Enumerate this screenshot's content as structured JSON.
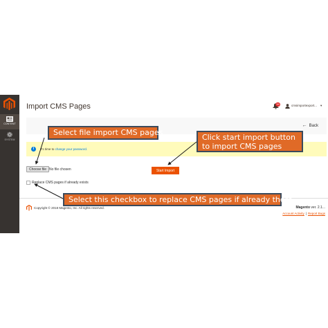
{
  "page": {
    "title": "Import CMS Pages",
    "back_label": "Back"
  },
  "sidenav": {
    "items": [
      {
        "label": "CONTENT",
        "icon": "content-icon",
        "active": true
      },
      {
        "label": "SYSTEM",
        "icon": "gear-icon",
        "active": false
      }
    ]
  },
  "header": {
    "notification_count": "39",
    "user_name": "cmsimportexport..."
  },
  "message": {
    "prefix": "It's time to",
    "link": "change your password."
  },
  "form": {
    "choose_file_label": "Choose file",
    "no_file_text": "No file chosen",
    "start_import_label": "Start Import",
    "replace_label": "Replace CMS pages if already exists"
  },
  "footer": {
    "copyright": "Copyright © 2018 Magento, Inc. All rights reserved.",
    "brand": "Magento",
    "version": "ver. 2.1...",
    "links": [
      "Account Activity",
      "Report Bugs"
    ]
  },
  "callouts": {
    "select_file": "Select file import CMS pages",
    "start_import": "Click start import button to import CMS pages",
    "checkbox": "Select this checkbox to replace CMS pages if already there"
  },
  "colors": {
    "accent": "#eb5202",
    "sidebar": "#373330",
    "callout": "#e06a27",
    "callout_border": "#3a4a5c",
    "message_bg": "#fffbbb",
    "info": "#007bdb"
  }
}
